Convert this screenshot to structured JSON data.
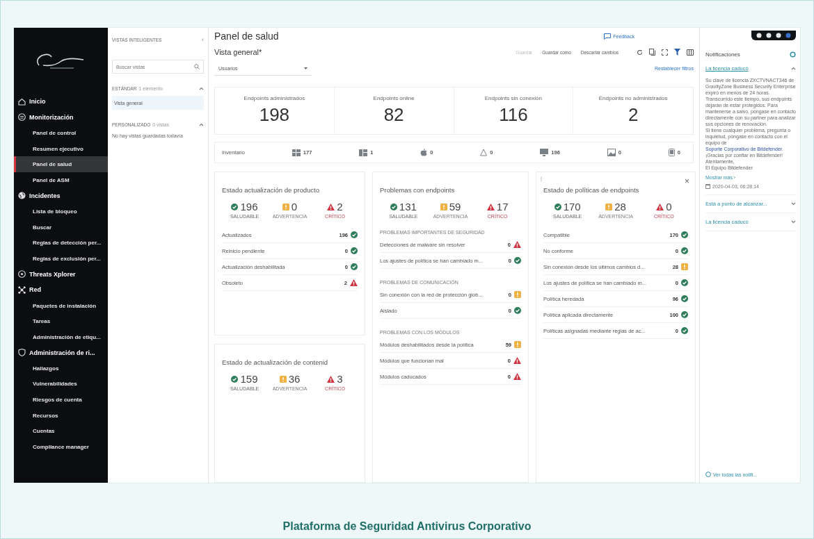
{
  "sidebar": {
    "items": [
      {
        "label": "Inicio",
        "kind": "section",
        "selected": false
      },
      {
        "label": "Monitorización",
        "kind": "section",
        "selected": false
      },
      {
        "label": "Panel de control",
        "kind": "item",
        "selected": false
      },
      {
        "label": "Resumen ejecutivo",
        "kind": "item",
        "selected": false
      },
      {
        "label": "Panel de salud",
        "kind": "item",
        "selected": true
      },
      {
        "label": "Panel de ASM",
        "kind": "item",
        "selected": false
      },
      {
        "label": "Incidentes",
        "kind": "section",
        "selected": false
      },
      {
        "label": "Lista de bloqueo",
        "kind": "item",
        "selected": false
      },
      {
        "label": "Buscar",
        "kind": "item",
        "selected": false
      },
      {
        "label": "Reglas de detección per...",
        "kind": "item",
        "selected": false
      },
      {
        "label": "Reglas de exclusión per...",
        "kind": "item",
        "selected": false
      },
      {
        "label": "Threats Xplorer",
        "kind": "section",
        "selected": false
      },
      {
        "label": "Red",
        "kind": "section",
        "selected": false
      },
      {
        "label": "Paquetes de instalación",
        "kind": "item",
        "selected": false
      },
      {
        "label": "Tareas",
        "kind": "item",
        "selected": false
      },
      {
        "label": "Administración de etiqu...",
        "kind": "item",
        "selected": false
      },
      {
        "label": "Administración de ri...",
        "kind": "section",
        "selected": false
      },
      {
        "label": "Hallazgos",
        "kind": "item",
        "selected": false
      },
      {
        "label": "Vulnerabilidades",
        "kind": "item",
        "selected": false
      },
      {
        "label": "Riesgos de cuenta",
        "kind": "item",
        "selected": false
      },
      {
        "label": "Recursos",
        "kind": "item",
        "selected": false
      },
      {
        "label": "Cuentas",
        "kind": "item",
        "selected": false
      },
      {
        "label": "Compliance manager",
        "kind": "item",
        "selected": false
      }
    ]
  },
  "views": {
    "title": "VISTAS INTELIGENTES",
    "collapse": "‹",
    "search_placeholder": "Buscar vistas",
    "groups": [
      {
        "label": "ESTÁNDAR",
        "count": "1 elemento",
        "expanded": true,
        "views": [
          {
            "label": "Vista general",
            "selected": true
          }
        ]
      },
      {
        "label": "PERSONALIZADO",
        "count": "0 vistas",
        "expanded": true,
        "empty": "No hay vistas guardadas todavía"
      }
    ]
  },
  "main": {
    "title": "Panel de salud",
    "feedback": "Feedback",
    "view_name": "Vista general*",
    "actions": [
      {
        "label": "Guardar",
        "disabled": true
      },
      {
        "label": "Guardar como",
        "disabled": false
      },
      {
        "label": "Descartar cambios",
        "disabled": false
      }
    ],
    "filter": {
      "value": "Usuarios"
    },
    "reset": "Restablecer filtros",
    "stats": [
      {
        "label": "Endpoints administrados",
        "value": "198"
      },
      {
        "label": "Endpoints online",
        "value": "82"
      },
      {
        "label": "Endpoints sin conexión",
        "value": "116"
      },
      {
        "label": "Endpoints no administrados",
        "value": "2"
      }
    ],
    "inventory": {
      "label": "Inventario",
      "items": [
        {
          "kind": "workstation",
          "count": "177"
        },
        {
          "kind": "server",
          "count": "1"
        },
        {
          "kind": "apple",
          "count": "0"
        },
        {
          "kind": "linux",
          "count": "0"
        },
        {
          "kind": "monitor",
          "count": "196"
        },
        {
          "kind": "image",
          "count": "0"
        },
        {
          "kind": "tablet",
          "count": "0"
        }
      ]
    },
    "cards": [
      {
        "title": "Estado actualización de producto",
        "summary": [
          {
            "kind": "ok",
            "value": "196",
            "label": "SALUDABLE"
          },
          {
            "kind": "warn",
            "value": "0",
            "label": "ADVERTENCIA"
          },
          {
            "kind": "crit",
            "value": "2",
            "label": "CRÍTICO"
          }
        ],
        "sections": [
          {
            "rows": [
              {
                "label": "Actualizados",
                "count": "196",
                "kind": "ok"
              },
              {
                "label": "Reinicio pendiente",
                "count": "0",
                "kind": "ok"
              },
              {
                "label": "Actualización deshabilitada",
                "count": "0",
                "kind": "ok"
              },
              {
                "label": "Obsoleto",
                "count": "2",
                "kind": "crit"
              }
            ]
          }
        ]
      },
      {
        "title": "Problemas con endpoints",
        "summary": [
          {
            "kind": "ok",
            "value": "131",
            "label": "SALUDABLE"
          },
          {
            "kind": "warn",
            "value": "59",
            "label": "ADVERTENCIA"
          },
          {
            "kind": "crit",
            "value": "17",
            "label": "CRÍTICO"
          }
        ],
        "sections": [
          {
            "heading": "PROBLEMAS IMPORTANTES DE SEGURIDAD",
            "rows": [
              {
                "label": "Detecciones de malware sin resolver",
                "count": "0",
                "kind": "crit"
              },
              {
                "label": "Los ajustes de política se han cambiado m...",
                "count": "0",
                "kind": "ok"
              }
            ]
          },
          {
            "heading": "PROBLEMAS DE COMUNICACIÓN",
            "rows": [
              {
                "label": "Sin conexión con la red de protección glob...",
                "count": "0",
                "kind": "warn"
              },
              {
                "label": "Aislado",
                "count": "0",
                "kind": "ok"
              }
            ]
          },
          {
            "heading": "PROBLEMAS CON LOS MÓDULOS",
            "rows": [
              {
                "label": "Módulos deshabilitados desde la política",
                "count": "59",
                "kind": "warn"
              },
              {
                "label": "Módulos que funcionan mal",
                "count": "0",
                "kind": "crit"
              },
              {
                "label": "Módulos caducados",
                "count": "0",
                "kind": "crit"
              }
            ]
          }
        ]
      },
      {
        "title": "Estado de políticas de endpoints",
        "close": "×",
        "summary": [
          {
            "kind": "ok",
            "value": "170",
            "label": "SALUDABLE"
          },
          {
            "kind": "warn",
            "value": "28",
            "label": "ADVERTENCIA"
          },
          {
            "kind": "crit",
            "value": "0",
            "label": "CRÍTICO"
          }
        ],
        "sections": [
          {
            "rows": [
              {
                "label": "Compatible",
                "count": "170",
                "kind": "ok"
              },
              {
                "label": "No conforme",
                "count": "0",
                "kind": "ok"
              },
              {
                "label": "Sin conexión desde los últimos cambios d...",
                "count": "28",
                "kind": "warn"
              },
              {
                "label": "Los ajustes de política se han cambiado m...",
                "count": "0",
                "kind": "ok"
              },
              {
                "label": "Política heredada",
                "count": "96",
                "kind": "ok"
              },
              {
                "label": "Política aplicada directamente",
                "count": "100",
                "kind": "ok"
              },
              {
                "label": "Políticas asignadas mediante reglas de ac...",
                "count": "0",
                "kind": "ok"
              }
            ]
          }
        ]
      },
      {
        "title": "Estado de actualización de contenid",
        "summary": [
          {
            "kind": "ok",
            "value": "159",
            "label": "SALUDABLE"
          },
          {
            "kind": "warn",
            "value": "36",
            "label": "ADVERTENCIA"
          },
          {
            "kind": "crit",
            "value": "3",
            "label": "CRÍTICO"
          }
        ]
      }
    ]
  },
  "notifications": {
    "title": "Notificaciones",
    "items": [
      {
        "title": "La licencia caducó",
        "expanded": true,
        "body_before": "Su clave de licencia ZXCTVNACT346 de GravityZone Business Security Enterprise expiró en menos de 24 horas. Transcurrido este tiempo, sus endpoints dejarán de estar protegidos. Para mantenerse a salvo, póngase en contacto directamente con su partner para analizar sus opciones de renovación.\nSi tiene cualquier problema, pregunta o inquietud, póngase en contacto con el equipo de ",
        "link": "Soporte Corporativo de Bitdefender",
        "body_after": ".\n¡Gracias por confiar en Bitdefender!\nAtentamente,\nEl Equipo Bitdefender",
        "more": "Mostrar más ›",
        "date": "2020-04-03, 06:28:14"
      },
      {
        "title": "Está a punto de alcanzar...",
        "expanded": false
      },
      {
        "title": "La licencia caducó",
        "expanded": false
      }
    ],
    "footer": "Ver todas las notifi..."
  },
  "caption": "Plataforma de Seguridad Antivirus Corporativo"
}
